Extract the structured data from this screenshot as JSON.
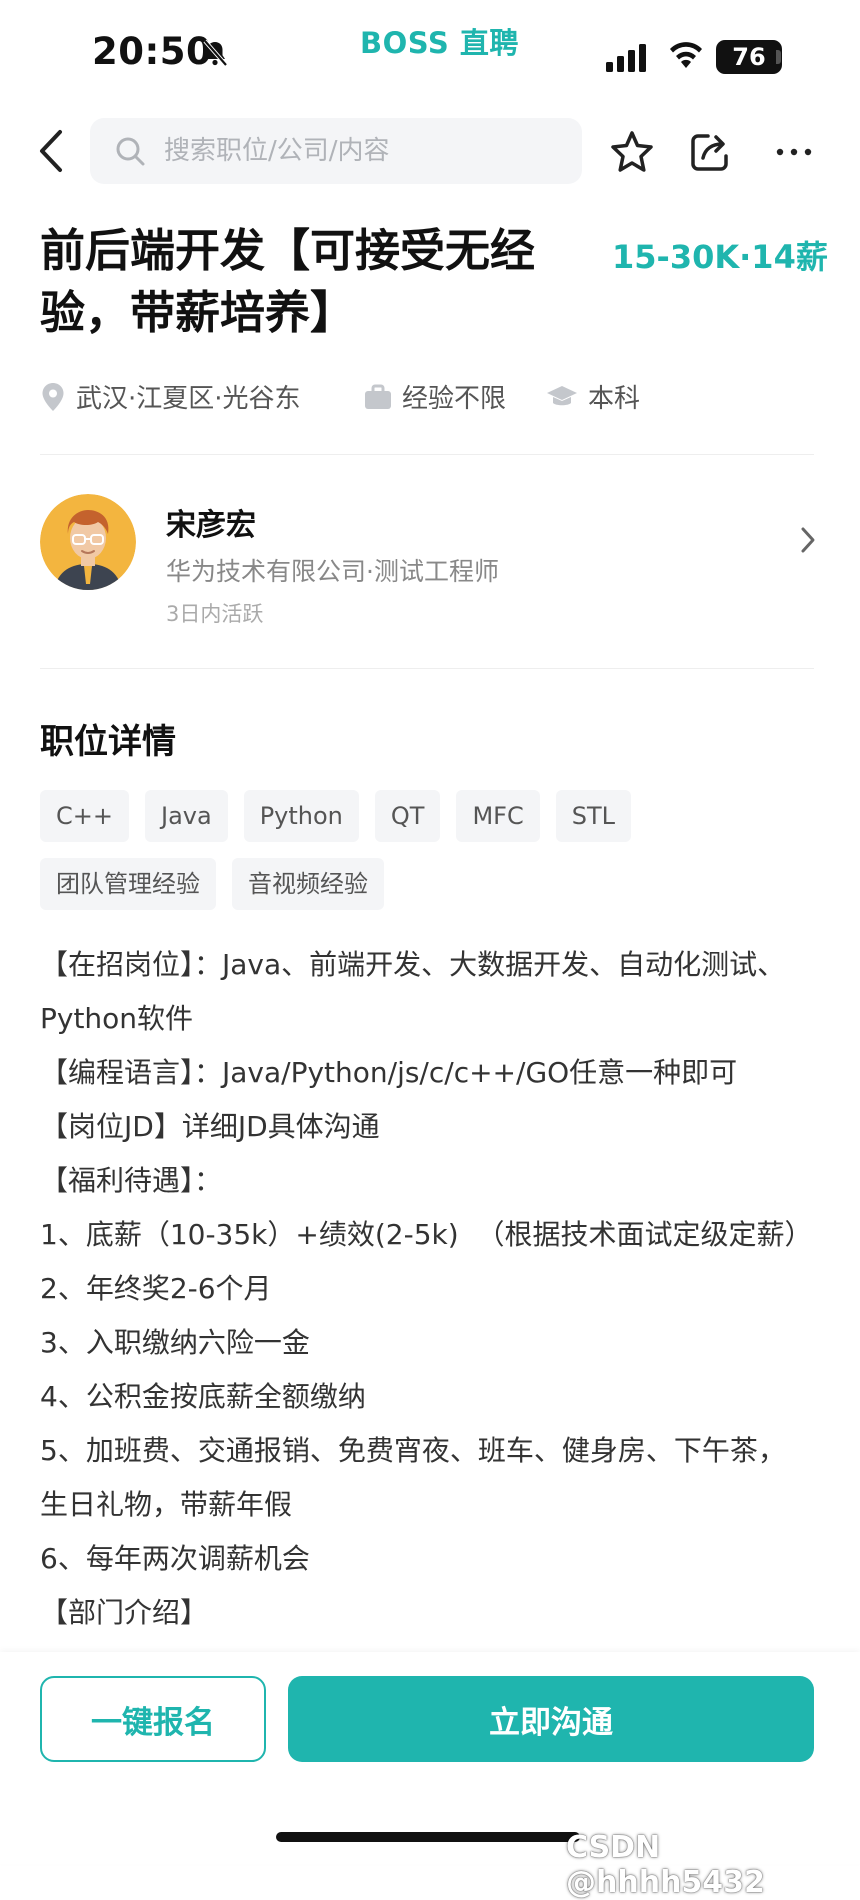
{
  "status_bar": {
    "time": "20:50",
    "app_brand": "BOSS 直聘",
    "battery": "76"
  },
  "search": {
    "placeholder": "搜索职位/公司/内容"
  },
  "job": {
    "title": "前后端开发【可接受无经验，带薪培养】",
    "salary": "15-30K·14薪",
    "location": "武汉·江夏区·光谷东",
    "experience": "经验不限",
    "education": "本科"
  },
  "recruiter": {
    "name": "宋彦宏",
    "info": "华为技术有限公司·测试工程师",
    "active": "3日内活跃"
  },
  "details": {
    "section_title": "职位详情",
    "tags": [
      "C++",
      "Java",
      "Python",
      "QT",
      "MFC",
      "STL",
      "团队管理经验",
      "音视频经验"
    ],
    "lines": [
      "【在招岗位】：Java、前端开发、大数据开发、自动化测试、Python软件",
      "【编程语言】：Java/Python/js/c/c++/GO任意一种即可",
      "【岗位JD】详细JD具体沟通",
      "【福利待遇】：",
      "1、底薪（10-35k）+绩效(2-5k)  （根据技术面试定级定薪）",
      "2、年终奖2-6个月",
      "3、入职缴纳六险一金",
      "4、公积金按底薪全额缴纳",
      "5、加班费、交通报销、免费宵夜、班车、健身房、下午茶，生日礼物，带薪年假",
      "6、每年两次调薪机会",
      "【部门介绍】"
    ]
  },
  "actions": {
    "apply_label": "一键报名",
    "chat_label": "立即沟通"
  },
  "watermark": "CSDN @hhhh5432",
  "colors": {
    "accent": "#1fb5ae"
  }
}
